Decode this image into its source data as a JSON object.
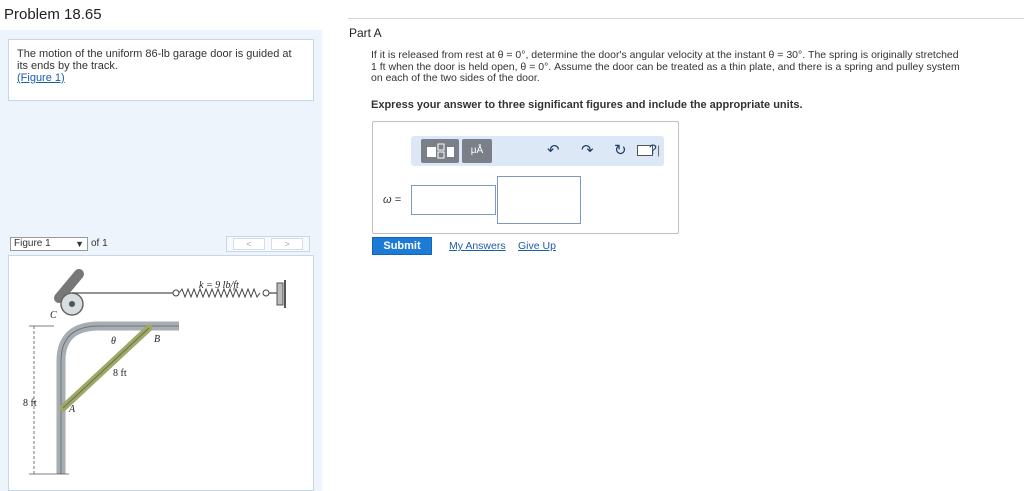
{
  "problem": {
    "title": "Problem 18.65"
  },
  "left": {
    "description_line1": "The motion of the uniform 86-lb garage door is guided at",
    "description_line2": "its ends by the track.",
    "figure_link": "(Figure 1)",
    "figure_select": "Figure 1",
    "figure_of": "of 1",
    "prev_label": "<",
    "next_label": ">"
  },
  "figure": {
    "spring_label": "k = 9 lb/ft",
    "label_c": "C",
    "label_theta": "θ",
    "label_b": "B",
    "label_8ft_door": "8 ft",
    "label_8ft_height": "8 ft",
    "label_a": "A"
  },
  "part": {
    "label": "Part A",
    "question_line1": "If it is released from rest at θ = 0°, determine the door's angular velocity at the instant θ = 30°. The spring is originally stretched",
    "question_line2": "1 ft when the door is held open, θ = 0°. Assume the door can be treated as a thin plate, and there is a spring and pulley system",
    "question_line3": "on each of the two sides of the door.",
    "instruction": "Express your answer to three significant figures and include the appropriate units."
  },
  "answer": {
    "omega_label": "ω =",
    "units_button": "μÅ",
    "undo_icon": "↶",
    "redo_icon": "↷",
    "reset_icon": "↻",
    "separator": "|",
    "help_icon": "?"
  },
  "actions": {
    "submit": "Submit",
    "my_answers": "My Answers",
    "give_up": "Give Up"
  }
}
